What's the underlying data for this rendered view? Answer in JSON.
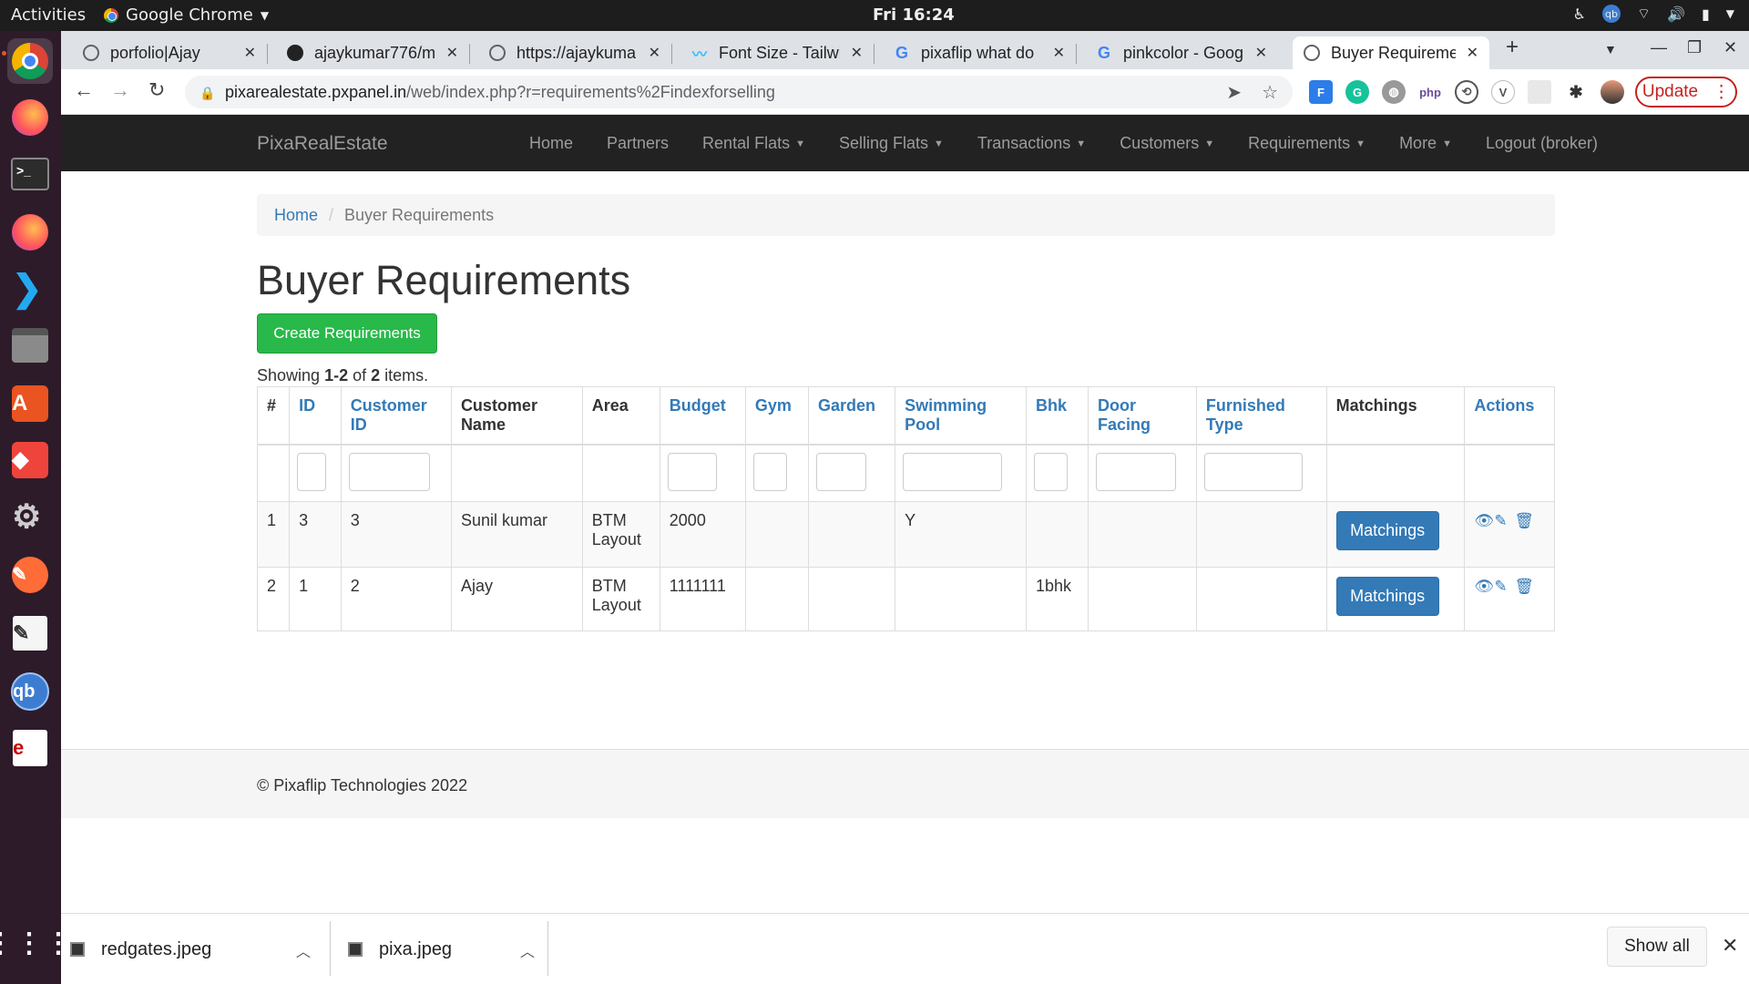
{
  "system_bar": {
    "activities": "Activities",
    "app_name": "Google Chrome",
    "clock": "Fri 16:24"
  },
  "tabs": [
    {
      "title": "porfolio|Ajay",
      "icon": "globe-icon"
    },
    {
      "title": "ajaykumar776/m",
      "icon": "github-icon"
    },
    {
      "title": "https://ajaykuma",
      "icon": "globe-icon"
    },
    {
      "title": "Font Size - Tailwi",
      "icon": "tailwind-icon"
    },
    {
      "title": "pixaflip what do",
      "icon": "google-icon"
    },
    {
      "title": "pinkcolor - Googl",
      "icon": "google-icon"
    },
    {
      "title": "Buyer Requireme",
      "icon": "globe-icon",
      "active": true
    }
  ],
  "address_bar": {
    "url_host": "pixarealestate.pxpanel.in",
    "url_path": "/web/index.php?r=requirements%2Findexforselling",
    "update_label": "Update"
  },
  "site": {
    "brand": "PixaRealEstate",
    "nav": [
      {
        "label": "Home",
        "dropdown": false
      },
      {
        "label": "Partners",
        "dropdown": false
      },
      {
        "label": "Rental Flats",
        "dropdown": true
      },
      {
        "label": "Selling Flats",
        "dropdown": true
      },
      {
        "label": "Transactions",
        "dropdown": true
      },
      {
        "label": "Customers",
        "dropdown": true
      },
      {
        "label": "Requirements",
        "dropdown": true
      },
      {
        "label": "More",
        "dropdown": true
      },
      {
        "label": "Logout (broker)",
        "dropdown": false
      }
    ]
  },
  "breadcrumb": {
    "home": "Home",
    "current": "Buyer Requirements"
  },
  "page": {
    "title": "Buyer Requirements",
    "create_button": "Create Requirements",
    "summary_prefix": "Showing ",
    "summary_range": "1-2",
    "summary_mid": " of ",
    "summary_total": "2",
    "summary_suffix": " items."
  },
  "table": {
    "columns": [
      {
        "label": "#",
        "sortable": false
      },
      {
        "label": "ID",
        "sortable": true
      },
      {
        "label": "Customer ID",
        "sortable": true
      },
      {
        "label": "Customer Name",
        "sortable": false
      },
      {
        "label": "Area",
        "sortable": false
      },
      {
        "label": "Budget",
        "sortable": true
      },
      {
        "label": "Gym",
        "sortable": true
      },
      {
        "label": "Garden",
        "sortable": true
      },
      {
        "label": "Swimming Pool",
        "sortable": true
      },
      {
        "label": "Bhk",
        "sortable": true
      },
      {
        "label": "Door Facing",
        "sortable": true
      },
      {
        "label": "Furnished Type",
        "sortable": true
      },
      {
        "label": "Matchings",
        "sortable": false
      },
      {
        "label": "Actions",
        "sortable": true
      }
    ],
    "filter_columns": [
      false,
      true,
      true,
      false,
      false,
      true,
      true,
      true,
      true,
      true,
      true,
      true,
      false,
      false
    ],
    "rows": [
      {
        "num": "1",
        "id": "3",
        "customer_id": "3",
        "customer_name": "Sunil kumar",
        "area": "BTM Layout",
        "budget": "2000",
        "gym": "",
        "garden": "",
        "swimming_pool": "Y",
        "bhk": "",
        "door_facing": "",
        "furnished_type": "",
        "matchings_label": "Matchings"
      },
      {
        "num": "2",
        "id": "1",
        "customer_id": "2",
        "customer_name": "Ajay",
        "area": "BTM Layout",
        "budget": "1111111",
        "gym": "",
        "garden": "",
        "swimming_pool": "",
        "bhk": "1bhk",
        "door_facing": "",
        "furnished_type": "",
        "matchings_label": "Matchings"
      }
    ]
  },
  "footer": {
    "copyright": "© Pixaflip Technologies 2022"
  },
  "downloads": {
    "items": [
      "redgates.jpeg",
      "pixa.jpeg"
    ],
    "show_all": "Show all"
  },
  "colors": {
    "navbar_bg": "#222222",
    "link": "#337ab7",
    "success": "#28b94a",
    "primary": "#337ab7"
  }
}
